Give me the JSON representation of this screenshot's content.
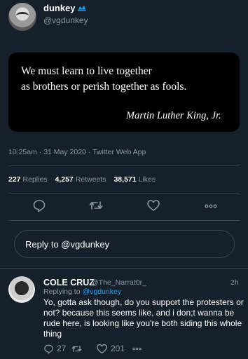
{
  "tweet": {
    "display_name": "dunkey",
    "handle": "@vgdunkey",
    "quote_lines": [
      "We must learn to live together",
      "as brothers or perish together as fools."
    ],
    "quote_author": "Martin Luther King, Jr.",
    "timestamp": "10:25am · 31 May 2020 · Twitter Web App",
    "stats": {
      "replies_count": "227",
      "replies_label": "Replies",
      "retweets_count": "4,257",
      "retweets_label": "Retweets",
      "likes_count": "38,571",
      "likes_label": "Likes"
    },
    "actions": [
      "reply-icon",
      "retweet-icon",
      "like-icon",
      "more-icon"
    ]
  },
  "composer": {
    "placeholder": "Reply to @vgdunkey"
  },
  "reply": {
    "display_name": "COLE CRUZ",
    "handle": "@The_Narrat0r_",
    "time": "2h",
    "replying_prefix": "Replying to",
    "replying_handle": "@vgdunkey",
    "text": "Yo, gotta ask though, do you support the protesters or not? because this seems like, and i don;t wanna be rude here, is looking like you're both siding this whole thing",
    "reply_count": "27",
    "like_count": "201"
  },
  "colors": {
    "background": "#15202b",
    "secondary_text": "#8899a6",
    "accent": "#1da1f2",
    "divider": "#38444d"
  }
}
